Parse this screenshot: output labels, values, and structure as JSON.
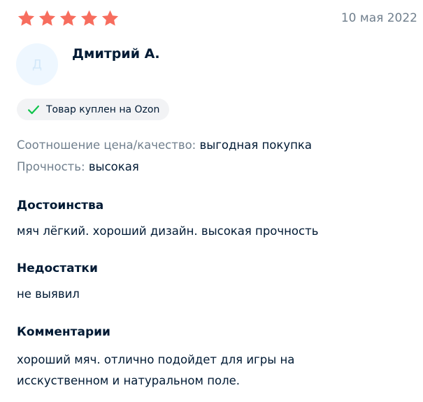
{
  "review": {
    "rating": 5,
    "rating_max": 5,
    "star_color": "#f76d5e",
    "date": "10 мая 2022",
    "author": {
      "initial": "Д",
      "name": "Дмитрий А."
    },
    "verified_badge": {
      "icon": "check-icon",
      "label": "Товар куплен на Ozon",
      "check_color": "#10c44c"
    },
    "attributes": [
      {
        "label": "Соотношение цена/качество:",
        "value": "выгодная покупка"
      },
      {
        "label": "Прочность:",
        "value": "высокая"
      }
    ],
    "sections": [
      {
        "title": "Достоинства",
        "text": "мяч лёгкий. хороший дизайн. высокая прочность"
      },
      {
        "title": "Недостатки",
        "text": "не выявил"
      },
      {
        "title": "Комментарии",
        "text": "хороший мяч. отлично подойдет для игры на исскуственном и натуральном поле."
      }
    ]
  }
}
